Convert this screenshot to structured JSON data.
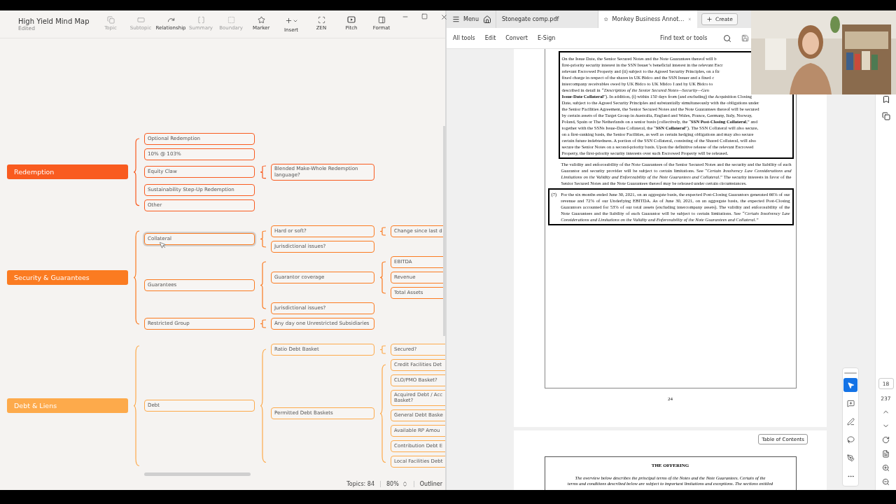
{
  "mindmap_app": {
    "title": "High Yield Mind Map",
    "status": "Edited",
    "tools": [
      {
        "kind": "topic",
        "label": "Topic",
        "disabled": true
      },
      {
        "kind": "subtopic",
        "label": "Subtopic",
        "disabled": true
      },
      {
        "kind": "relationship",
        "label": "Relationship",
        "disabled": false
      },
      {
        "kind": "summary",
        "label": "Summary",
        "disabled": true
      },
      {
        "kind": "boundary",
        "label": "Boundary",
        "disabled": true
      },
      {
        "kind": "marker",
        "label": "Marker",
        "disabled": false
      },
      {
        "kind": "insert",
        "label": "Insert",
        "disabled": false
      },
      {
        "kind": "zen",
        "label": "ZEN",
        "disabled": false
      },
      {
        "kind": "pitch",
        "label": "Pitch",
        "disabled": false
      },
      {
        "kind": "format",
        "label": "Format",
        "disabled": false
      }
    ],
    "topics": [
      {
        "label": "Redemption",
        "color": "#f95b1f",
        "selected": false,
        "children": [
          {
            "label": "Optional Redemption",
            "selected": false
          },
          {
            "label": "10% @ 103%",
            "selected": false
          },
          {
            "label": "Equity Claw",
            "selected": false,
            "children": [
              {
                "label": "Blended Make-Whole Redemption language?",
                "selected": false
              }
            ]
          },
          {
            "label": "Sustainability Step-Up Redemption",
            "selected": false
          },
          {
            "label": "Other",
            "selected": false
          }
        ]
      },
      {
        "label": "Security & Guarantees",
        "color": "#fb7b21",
        "selected": false,
        "children": [
          {
            "label": "Collateral",
            "selected": true,
            "children": [
              {
                "label": "Hard or soft?",
                "selected": false,
                "children": [
                  {
                    "label": "Change since last d",
                    "selected": false
                  }
                ]
              },
              {
                "label": "Jurisdictional issues?",
                "selected": false
              }
            ]
          },
          {
            "label": "Guarantees",
            "selected": false,
            "children": [
              {
                "label": "Guarantor coverage",
                "selected": false,
                "children": [
                  {
                    "label": "EBITDA",
                    "selected": false
                  },
                  {
                    "label": "Revenue",
                    "selected": false
                  },
                  {
                    "label": "Total Assets",
                    "selected": false
                  }
                ]
              },
              {
                "label": "Jurisdictional issues?",
                "selected": false
              }
            ]
          },
          {
            "label": "Restricted Group",
            "selected": false,
            "children": [
              {
                "label": "Any day one Unrestricted Subsidiaries",
                "selected": false
              }
            ]
          }
        ]
      },
      {
        "label": "Debt & Liens",
        "color": "#fdaa4b",
        "selected": false,
        "children": [
          {
            "label": "Debt",
            "selected": false,
            "children": [
              {
                "label": "Ratio Debt Basket",
                "selected": false,
                "children": [
                  {
                    "label": "Secured?",
                    "selected": false
                  }
                ]
              },
              {
                "label": "Permitted Debt Baskets",
                "selected": false,
                "children": [
                  {
                    "label": "Credit Facilities Det",
                    "selected": false
                  },
                  {
                    "label": "CLO/PMO Basket?",
                    "selected": false
                  },
                  {
                    "label": "Acquired Debt / Acc\nBasket?",
                    "selected": false
                  },
                  {
                    "label": "General Debt Baske",
                    "selected": false
                  },
                  {
                    "label": "Available RP Amou",
                    "selected": false
                  },
                  {
                    "label": "Contribution Debt E",
                    "selected": false
                  },
                  {
                    "label": "Local Facilities Debt",
                    "selected": false
                  }
                ]
              }
            ]
          }
        ]
      }
    ],
    "status_bar": {
      "topics": "Topics: 84",
      "zoom": "80%",
      "outliner": "Outliner"
    }
  },
  "pdf_app": {
    "menu": "Menu",
    "tabs": [
      {
        "label": "Stonegate comp.pdf",
        "selected": false
      },
      {
        "label": "Monkey Business Annot…",
        "selected": true
      }
    ],
    "create": "Create",
    "toolbar": [
      "All tools",
      "Edit",
      "Convert",
      "E-Sign"
    ],
    "search": {
      "placeholder": "Find text or tools"
    },
    "page": {
      "boxed_lines": [
        "On the Issue Date, the Senior Secured Notes and the Note Guarantees thereof will b",
        "first-priority security interest in the SSN Issuer’s beneficial interest in the relevant Escr",
        "relevant Escrowed Property and (ii) subject to the Agreed Security Principles, on a fir",
        "fixed charge in respect of the shares in UK Bidco and the SSN Issuer and a fixed c",
        "intercompany receivables owed by UK Bidco to UK Midco I and by UK Bidco to",
        "described in detail in *“Description of the Senior Secured Notes—Security—Gen*",
        "**Issue-Date Collateral**”). In addition, (i) within 150 days from (and excluding) the Acquisition Closing",
        "Date, subject to the Agreed Security Principles and substantially simultaneously with the obligations under",
        "the Senior Facilities Agreement, the Senior Secured Notes and the Note Guarantees thereof will be secured",
        "by certain assets of the Target Group in Australia, England and Wales, France, Germany, Italy, Norway,",
        "Poland, Spain or The Netherlands on a senior basis (collectively, the “**SSN Post-Closing Collateral**,” and",
        "together with the SSNs Issue-Date Collateral, the “**SSN Collateral**”). The SSN Collateral will also secure,",
        "on a first-ranking basis, the Senior Facilities, as well as certain hedging obligations and may also secure",
        "certain future indebtedness. A portion of the SSN Collateral, consisting of the Shared Collateral, will also",
        "secure the Senior Notes on a second-priority basis. Upon the definitive release of the relevant Escrowed",
        "Property, the first-priority security interests over such Escrowed Property will be released."
      ],
      "paragraph": "The validity and enforceability of the Note Guarantees of the Senior Secured Notes and the security and the liability of each Guarantor and security provider will be subject to certain limitations. See “*Certain Insolvency Law Considerations and Limitations on the Validity and Enforceability of the Note Guarantees and Collateral.*” The security interests in favor of the Senior Secured Notes and the Note Guarantees thereof may be released under certain circumstances.",
      "note": {
        "number": "(7)",
        "text": "For the six months ended June 30, 2021, on an aggregate basis, the expected Post-Closing Guarantors generated 66% of our revenue and 72% of our Underlying EBITDA. As of June 30, 2021, on an aggregate basis, the expected Post-Closing Guarantors accounted for 53% of our total assets (excluding intercompany assets). The validity and enforceability of the Note Guarantees and the liability of each Guarantor will be subject to certain limitations. See *“Certain Insolvency Law Considerations and Limitations on the Validity and Enforceability of the Note Guarantees and Collateral.”*"
      },
      "page_number": "24"
    },
    "toc_button": "Table of Contents",
    "next_page": {
      "heading": "THE OFFERING",
      "lines": [
        "The overview below describes the principal terms of the Notes and the Note Guarantees. Certain of the",
        "terms and conditions described below are subject to important limitations and exceptions. The sections entitled"
      ]
    },
    "page_field": {
      "value": "18"
    },
    "page_count": "237",
    "tools": [
      {
        "kind": "select",
        "selected": true
      },
      {
        "kind": "comment",
        "selected": false
      },
      {
        "kind": "draw",
        "selected": false
      },
      {
        "kind": "lasso",
        "selected": false
      },
      {
        "kind": "sign",
        "selected": false
      },
      {
        "kind": "more",
        "selected": false
      }
    ]
  }
}
